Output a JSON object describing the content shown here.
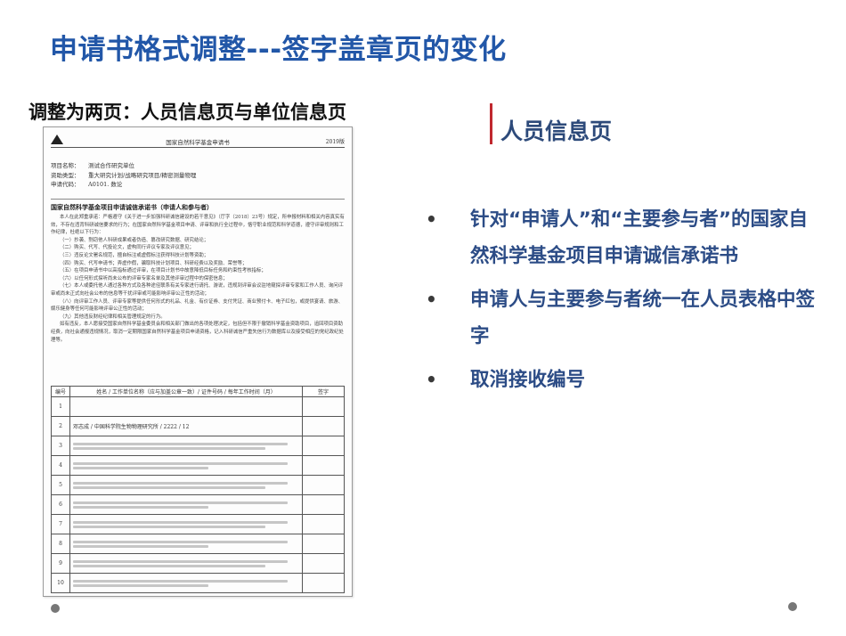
{
  "slide": {
    "title": "申请书格式调整---签字盖章页的变化",
    "subtitle": "调整为两页：人员信息页与单位信息页",
    "section_title": "人员信息页",
    "bullets": [
      "针对“申请人”和“主要参与者”的国家自然科学基金项目申请诚信承诺书",
      "申请人与主要参与者统一在人员表格中签字",
      "取消接收编号"
    ],
    "colors": {
      "title": "#2257a8",
      "bullet_text": "#2c4c86",
      "accent_bar": "#c0282e"
    }
  },
  "document": {
    "header_center": "国家自然科学基金申请书",
    "header_version": "2019版",
    "info": [
      {
        "k": "项目名称：",
        "v": "测试合作研究单位"
      },
      {
        "k": "资助类型：",
        "v": "重大研究计划/战略研究项目/精密测量物理"
      },
      {
        "k": "申请代码：",
        "v": "A0101. 数论"
      }
    ],
    "section_heading": "国家自然科学基金项目申请诚信承诺书（申请人和参与者）",
    "paragraphs": [
      "本人在此郑重承诺：严格遵守《关于进一步加强科研诚信建设的若干意见》（厅字〔2018〕23号）规定，所申报材料和相关内容真实有效，不存在违背科研诚信要求的行为；在国家自然科学基金项目申请、评审和执行全过程中，恪守职业规范和科学道德，遵守评审规则和工作纪律，杜绝以下行为：",
      "（一）抄袭、剽窃他人科研成果或者伪造、篡改研究数据、研究结论；",
      "（二）购买、代写、代投论文，虚构同行评议专家及评议意见；",
      "（三）违反论文署名规范，擅自标注或虚假标注获得科技计划等资助；",
      "（四）购买、代写申请书；弄虚作假，骗取科技计划项目、科研经费以及奖励、荣誉等；",
      "（五）在项目申请书中以高指标通过评审，在项目计划书中故意降低目标任务和约束性考核指标；",
      "（六）以任何形式探听尚未公布的评审专家名单及其他评审过程中的保密信息；",
      "（七）本人或委托他人通过各种方式及各种途径联系有关专家进行请托、游说，违规到评审会议驻地窥探评审专家和工作人员、询问评审或尚未正式向社会公布的信息等干扰评审或可能影响评审公正性的活动；",
      "（八）向评审工作人员、评审专家等提供任何形式的礼品、礼金、有价证券、支付凭证、商业预付卡、电子红包，或提供宴请、旅游、娱乐健身等任何可能影响评审公正性的活动；",
      "（九）其他违反财经纪律和相关管理规定的行为。",
      "如有违反，本人愿接受国家自然科学基金委员会和相关部门做出的各项处理决定，包括但不限于撤销科学基金资助项目，追回项目资助经费，向社会通报违规情况，取消一定期限国家自然科学基金项目申请资格，记入科研诚信严重失信行为数据库以及接受相应的党纪政纪处理等。"
    ],
    "table_headers": [
      "编号",
      "姓名 / 工作单位名称（应与加盖公章一致）/ 证件号码 / 每年工作时间（月）",
      "签字"
    ],
    "table_rows": [
      {
        "num": "1",
        "text": ""
      },
      {
        "num": "2",
        "text": "邓志成 / 中国科学院生物物理研究所 / 2222 / 12"
      },
      {
        "num": "3",
        "text": ""
      },
      {
        "num": "4",
        "text": ""
      },
      {
        "num": "5",
        "text": ""
      },
      {
        "num": "6",
        "text": ""
      },
      {
        "num": "7",
        "text": ""
      },
      {
        "num": "8",
        "text": ""
      },
      {
        "num": "9",
        "text": ""
      },
      {
        "num": "10",
        "text": ""
      }
    ]
  }
}
